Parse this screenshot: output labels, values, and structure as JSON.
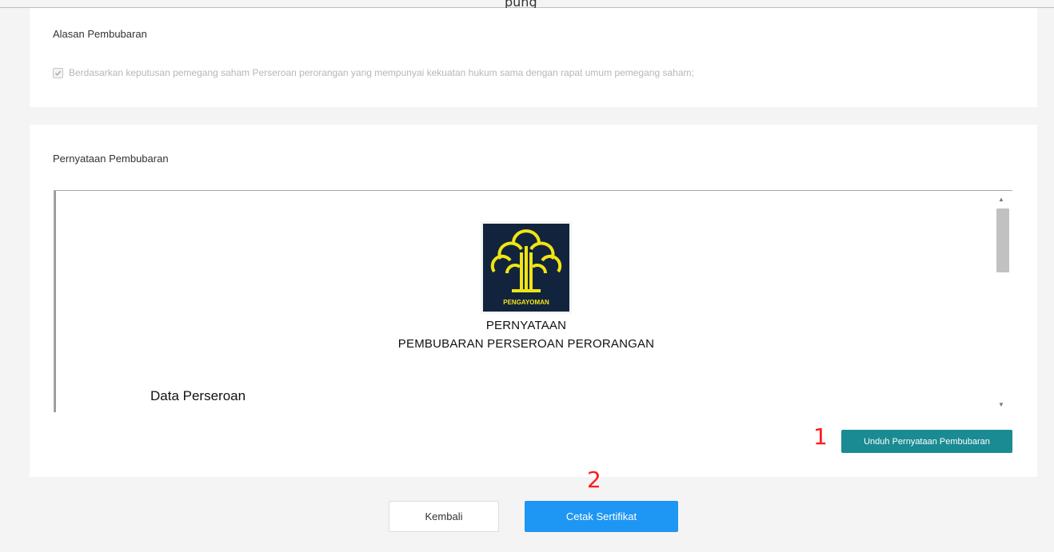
{
  "top_fragment": "pung",
  "reason_section": {
    "label": "Alasan Pembubaran",
    "checked": true,
    "option_text": "Berdasarkan keputusan pemegang saham Perseroan perorangan yang mempunyai kekuatan hukum sama dengan rapat umum pemegang saham;"
  },
  "statement_section": {
    "label": "Pernyataan Pembubaran",
    "document": {
      "logo_text": "PENGAYOMAN",
      "title_line1": "PERNYATAAN",
      "title_line2": "PEMBUBARAN PERSEROAN PERORANGAN",
      "subheading": "Data Perseroan"
    },
    "download_button": "Unduh Pernyataan Pembubaran"
  },
  "annotations": {
    "marker1": "1",
    "marker2": "2",
    "color": "#ff1a1a"
  },
  "footer": {
    "back_button": "Kembali",
    "print_button": "Cetak Sertifikat"
  },
  "colors": {
    "download_button": "#1b8b93",
    "print_button": "#1e96f3",
    "logo_background": "#12243d",
    "logo_emblem": "#f0e514"
  }
}
